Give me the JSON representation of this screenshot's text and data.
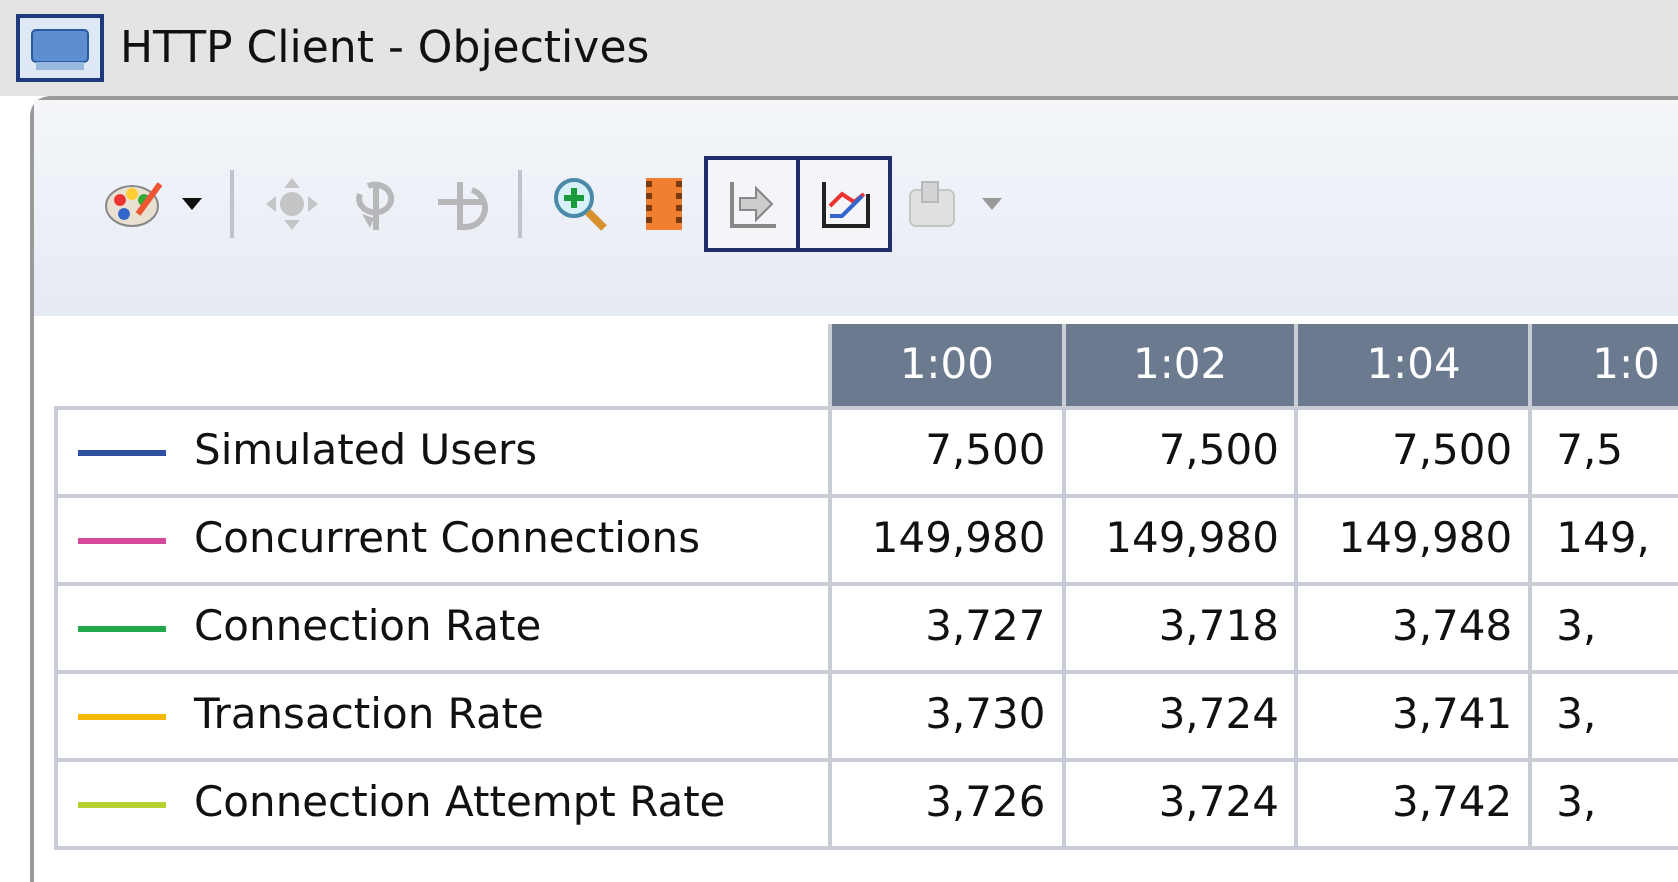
{
  "window": {
    "title": "HTTP Client - Objectives"
  },
  "toolbar": [
    {
      "kind": "palette",
      "disabled": false,
      "pressed": false,
      "dropdown": true
    },
    {
      "kind": "separator"
    },
    {
      "kind": "move",
      "disabled": true,
      "pressed": false,
      "dropdown": false
    },
    {
      "kind": "rotate",
      "disabled": true,
      "pressed": false,
      "dropdown": false
    },
    {
      "kind": "flip",
      "disabled": true,
      "pressed": false,
      "dropdown": false
    },
    {
      "kind": "separator"
    },
    {
      "kind": "zoom",
      "disabled": false,
      "pressed": false,
      "dropdown": false
    },
    {
      "kind": "film",
      "disabled": false,
      "pressed": false,
      "dropdown": false
    },
    {
      "kind": "export",
      "disabled": false,
      "pressed": true,
      "dropdown": false
    },
    {
      "kind": "chart",
      "disabled": false,
      "pressed": true,
      "dropdown": false
    },
    {
      "kind": "clipboard",
      "disabled": true,
      "pressed": false,
      "dropdown": true
    }
  ],
  "table": {
    "columns": [
      "1:00",
      "1:02",
      "1:04",
      "1:0"
    ],
    "rows": [
      {
        "name": "Simulated Users",
        "color": "#2f4fa0",
        "values": [
          "7,500",
          "7,500",
          "7,500",
          "7,5"
        ]
      },
      {
        "name": "Concurrent Connections",
        "color": "#d6489a",
        "values": [
          "149,980",
          "149,980",
          "149,980",
          "149,"
        ]
      },
      {
        "name": "Connection Rate",
        "color": "#22a84a",
        "values": [
          "3,727",
          "3,718",
          "3,748",
          "3,"
        ]
      },
      {
        "name": "Transaction Rate",
        "color": "#f5b800",
        "values": [
          "3,730",
          "3,724",
          "3,741",
          "3,"
        ]
      },
      {
        "name": "Connection Attempt Rate",
        "color": "#b8d030",
        "values": [
          "3,726",
          "3,724",
          "3,742",
          "3,"
        ]
      }
    ]
  }
}
